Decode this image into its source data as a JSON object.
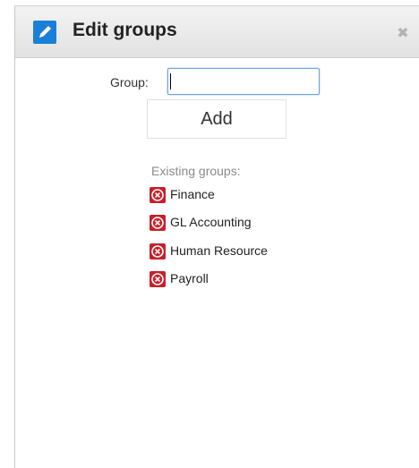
{
  "dialog": {
    "title": "Edit groups",
    "close_glyph": "✖"
  },
  "form": {
    "group_label": "Group:",
    "group_value": "",
    "add_label": "Add"
  },
  "existing": {
    "label": "Existing groups:",
    "groups": [
      "Finance",
      "GL Accounting",
      "Human Resource",
      "Payroll"
    ]
  },
  "icons": {
    "title": "pencil-icon",
    "close": "close-icon",
    "remove": "remove-group-icon"
  },
  "colors": {
    "accent": "#1a7fd8",
    "remove": "#c8202a"
  }
}
